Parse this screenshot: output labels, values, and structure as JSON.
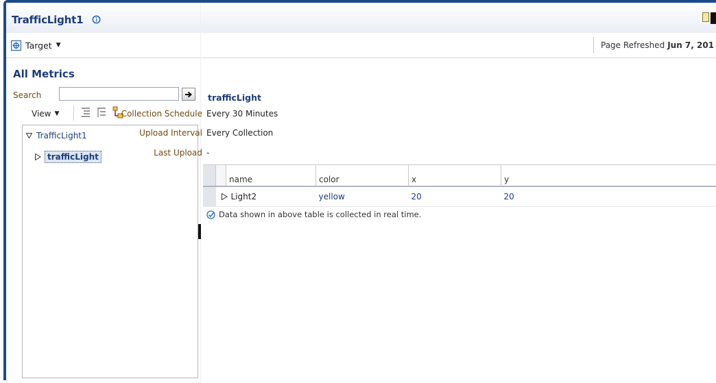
{
  "header": {
    "title": "TrafficLight1",
    "target_menu_label": "Target",
    "refresh_label": "Page Refreshed",
    "refresh_date": "Jun 7, 201"
  },
  "sidebar": {
    "section_title": "All Metrics",
    "search_label": "Search",
    "search_value": "",
    "view_menu_label": "View",
    "tree": {
      "root_label": "TrafficLight1",
      "child_label": "trafficLight"
    }
  },
  "main": {
    "metric_title": "trafficLight",
    "properties": [
      {
        "label": "Collection Schedule",
        "value": "Every 30 Minutes"
      },
      {
        "label": "Upload Interval",
        "value": "Every Collection"
      },
      {
        "label": "Last Upload",
        "value": "-"
      }
    ],
    "table": {
      "columns": [
        "name",
        "color",
        "x",
        "y"
      ],
      "rows": [
        {
          "name": "Light2",
          "color": "yellow",
          "x": "20",
          "y": "20"
        }
      ]
    },
    "footnote": "Data shown in above table is collected in real time."
  },
  "colors": {
    "frame": "#1c4b8c",
    "title": "#1e3c78",
    "label": "#6d4a10"
  },
  "icons": [
    "info-icon",
    "target-icon",
    "arrow-right-icon",
    "expand-all-icon",
    "collapse-all-icon",
    "tree-icon",
    "triangle-down-icon",
    "triangle-right-icon",
    "check-circle-icon"
  ]
}
